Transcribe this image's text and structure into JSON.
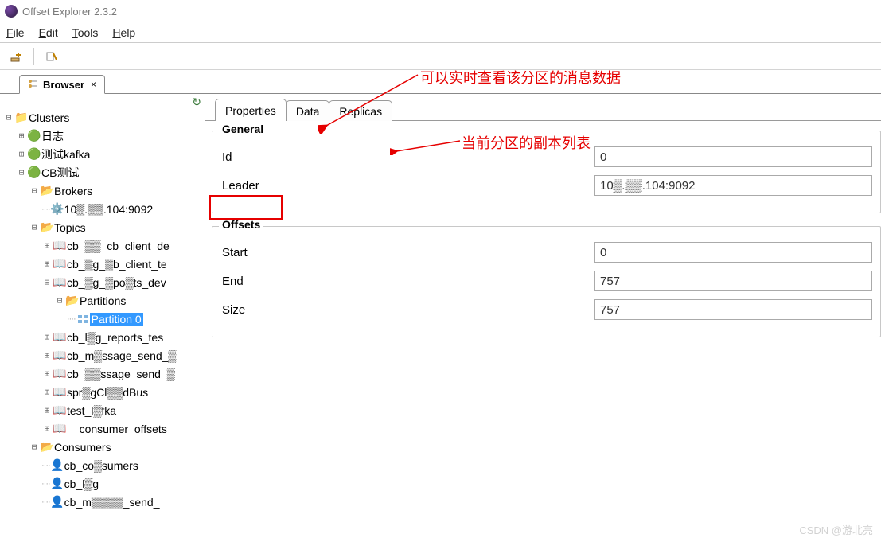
{
  "window": {
    "title": "Offset Explorer  2.3.2"
  },
  "menu": {
    "file": "File",
    "edit": "Edit",
    "tools": "Tools",
    "help": "Help"
  },
  "browser_tab": {
    "label": "Browser"
  },
  "tree": {
    "root": "Clusters",
    "n1": "日志",
    "n2": "测试kafka",
    "n3": "CB测试",
    "brokers": "Brokers",
    "broker1": "10▒.▒▒.104:9092",
    "topics": "Topics",
    "t1": "cb_▒▒_cb_client_de",
    "t2": "cb_▒g_▒b_client_te",
    "t3": "cb_▒g_▒po▒ts_dev",
    "partitions": "Partitions",
    "partition0": "Partition 0",
    "t4": "cb_l▒g_reports_tes",
    "t5": "cb_m▒ssage_send_▒",
    "t6": "cb_▒▒ssage_send_▒",
    "t7": "spr▒gCl▒▒dBus",
    "t8": "test_l▒fka",
    "t9": "__consumer_offsets",
    "consumers": "Consumers",
    "c1": "cb_co▒sumers",
    "c2": "cb_l▒g",
    "c3": "cb_m▒▒▒▒_send_"
  },
  "tabs": {
    "properties": "Properties",
    "data": "Data",
    "replicas": "Replicas"
  },
  "general": {
    "legend": "General",
    "id_label": "Id",
    "id_value": "0",
    "leader_label": "Leader",
    "leader_value": "10▒.▒▒.104:9092"
  },
  "offsets": {
    "legend": "Offsets",
    "start_label": "Start",
    "start_value": "0",
    "end_label": "End",
    "end_value": "757",
    "size_label": "Size",
    "size_value": "757"
  },
  "annotations": {
    "a1": "可以实时查看该分区的消息数据",
    "a2": "当前分区的副本列表"
  },
  "watermark": "CSDN @游北亮"
}
